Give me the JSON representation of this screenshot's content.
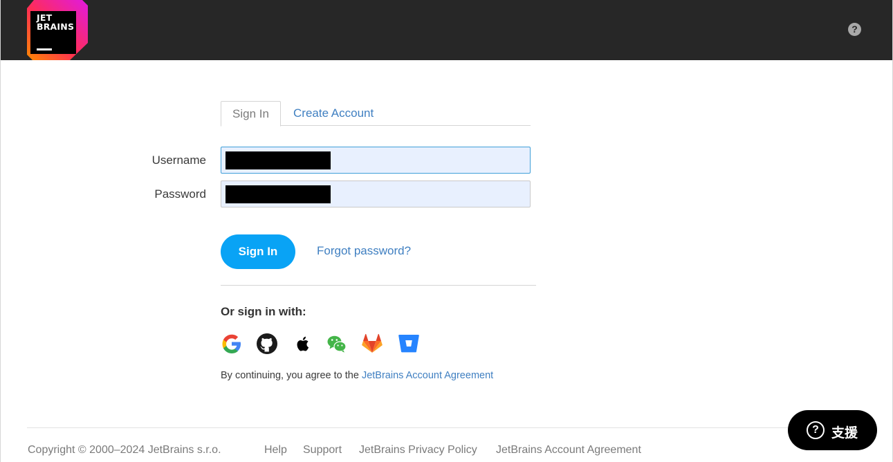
{
  "header": {
    "logo_line1": "JET",
    "logo_line2": "BRAINS",
    "help_glyph": "?"
  },
  "tabs": {
    "sign_in": "Sign In",
    "create_account": "Create Account"
  },
  "form": {
    "username_label": "Username",
    "password_label": "Password",
    "username_value": "",
    "password_value": "",
    "sign_in_button": "Sign In",
    "forgot_password": "Forgot password?"
  },
  "social": {
    "heading": "Or sign in with:",
    "providers": [
      "google-icon",
      "github-icon",
      "apple-icon",
      "wechat-icon",
      "gitlab-icon",
      "bitbucket-icon"
    ]
  },
  "agreement": {
    "prefix": "By continuing, you agree to the ",
    "link": "JetBrains Account Agreement"
  },
  "footer": {
    "copyright": "Copyright © 2000–2024 JetBrains s.r.o.",
    "help": "Help",
    "support": "Support",
    "privacy": "JetBrains Privacy Policy",
    "agreement": "JetBrains Account Agreement"
  },
  "support_widget": {
    "glyph": "?",
    "label": "支援"
  },
  "colors": {
    "header_bg": "#272727",
    "accent_blue": "#09a3f5",
    "link_blue": "#3f7fc1",
    "input_bg": "#e8f0fe"
  }
}
